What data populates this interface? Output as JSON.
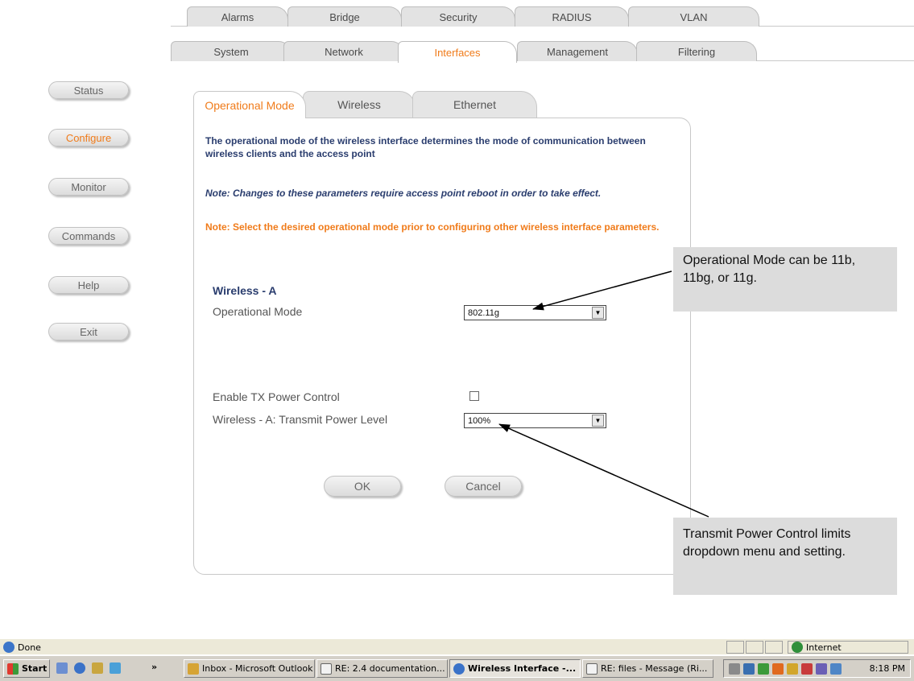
{
  "top_tabs": {
    "row1": [
      "Alarms",
      "Bridge",
      "Security",
      "RADIUS",
      "VLAN"
    ],
    "row2": [
      "System",
      "Network",
      "Interfaces",
      "Management",
      "Filtering"
    ],
    "active": "Interfaces"
  },
  "nav": {
    "items": [
      "Status",
      "Configure",
      "Monitor",
      "Commands",
      "Help",
      "Exit"
    ],
    "active": "Configure"
  },
  "sub_tabs": {
    "items": [
      "Operational Mode",
      "Wireless",
      "Ethernet"
    ],
    "active": "Operational Mode"
  },
  "content": {
    "intro": "The operational mode of the wireless interface determines the mode of communication between wireless clients and the access point",
    "note1": "Note: Changes to these parameters require access point reboot in order to take effect.",
    "note2": "Note: Select the desired operational mode prior to configuring other wireless interface parameters.",
    "section_title": "Wireless - A",
    "op_mode_label": "Operational Mode",
    "op_mode_value": "802.11g",
    "tx_enable_label": "Enable TX Power Control",
    "tx_enable_checked": false,
    "tx_level_label": "Wireless - A: Transmit Power Level",
    "tx_level_value": "100%",
    "ok_label": "OK",
    "cancel_label": "Cancel"
  },
  "callouts": {
    "op_mode": "Operational Mode can be 11b, 11bg, or 11g.",
    "tx_power": "Transmit Power Control limits dropdown menu and setting."
  },
  "statusbar": {
    "status": "Done",
    "zone": "Internet"
  },
  "taskbar": {
    "start": "Start",
    "chevron": "»",
    "buttons": [
      "Inbox - Microsoft Outlook",
      "RE: 2.4 documentation...",
      "Wireless Interface -...",
      "RE: files - Message (Ri..."
    ],
    "active_button": "Wireless Interface -...",
    "clock": "8:18 PM"
  },
  "colors": {
    "accent": "#f07b1a",
    "heading": "#2a3d6e",
    "tab_bg": "#e3e3e3",
    "callout_bg": "#dcdcdc"
  }
}
